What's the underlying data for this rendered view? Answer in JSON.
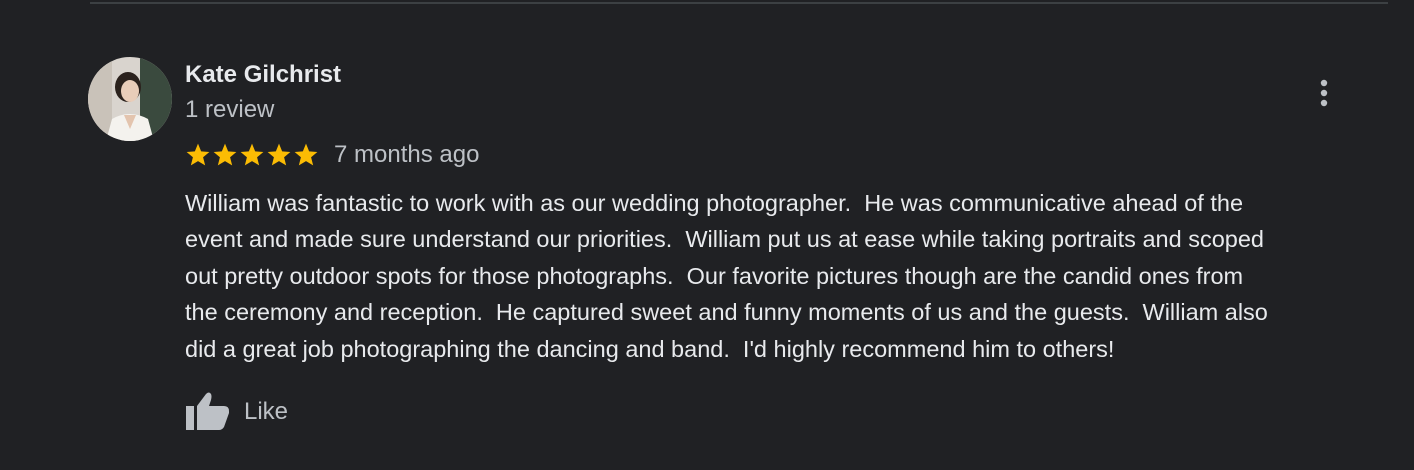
{
  "review": {
    "author_name": "Kate Gilchrist",
    "author_review_count": "1 review",
    "rating": 5,
    "rating_max": 5,
    "time_ago": "7 months ago",
    "lines": [
      "William was fantastic to work with as our wedding photographer.  He was communicative ahead of the",
      "event and made sure understand our priorities.  William put us at ease while taking portraits and scoped",
      "out pretty outdoor spots for those photographs.  Our favorite pictures though are the candid ones from",
      "the ceremony and reception.  He captured sweet and funny moments of us and the guests.  William also",
      "did a great job photographing the dancing and band.  I'd highly recommend him to others!"
    ],
    "like_label": "Like",
    "icons": {
      "menu": "more-vert-icon",
      "like": "thumb-up-icon",
      "star": "star-icon"
    }
  },
  "colors": {
    "background": "#202124",
    "star": "#fbbc04",
    "primary_text": "#e8eaed",
    "secondary_text": "#bdc1c6",
    "icon": "#bdc1c6"
  }
}
